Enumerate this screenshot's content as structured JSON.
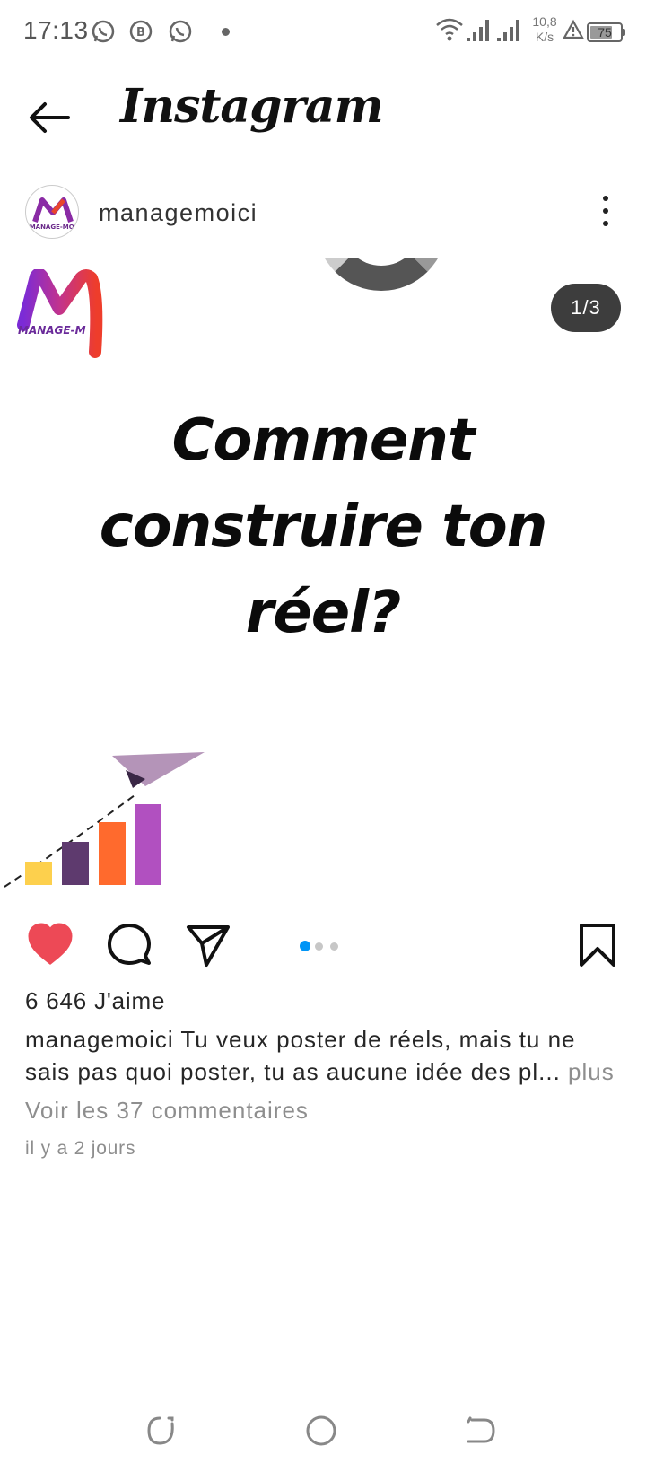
{
  "status_bar": {
    "time": "17:13",
    "notification_icons": [
      "whatsapp-icon",
      "b-app-icon",
      "whatsapp-icon"
    ],
    "network_speed_value": "10,8",
    "network_speed_unit": "K/s",
    "battery_level": "75",
    "icons": [
      "wifi-icon",
      "signal-icon",
      "signal-icon",
      "alert-icon",
      "battery-icon"
    ]
  },
  "header": {
    "title": "Instagram",
    "back_icon": "arrow-left-icon"
  },
  "post": {
    "username": "managemoici",
    "avatar_text": "MANAGE-MOI",
    "more_icon": "more-vertical-icon",
    "slide_index": "1/3",
    "slide_count": 3,
    "active_slide": 1,
    "slide_brand": "MANAGE-M",
    "slide_heading": "Comment construire ton réel?",
    "likes_text": "6 646 J'aime",
    "caption_username": "managemoici",
    "caption_text": " Tu veux poster de réels, mais tu ne sais pas quoi poster, tu as aucune idée des pl...",
    "caption_more": " plus",
    "comments_link": "Voir les 37 commentaires",
    "time_ago": "il y a 2 jours",
    "liked": true,
    "action_icons": [
      "heart-icon",
      "comment-icon",
      "share-icon",
      "bookmark-icon"
    ]
  },
  "colors": {
    "like_red": "#ed4956",
    "dot_active": "#0095f6",
    "dot_inactive": "#c7c7c7",
    "bar_yellow": "#fdd04d",
    "bar_purple_dark": "#5e3a6e",
    "bar_orange": "#ff6a2d",
    "bar_purple": "#b150c0",
    "plane": "#b494b8"
  },
  "nav_bar": {
    "icons": [
      "recent-apps-icon",
      "home-icon",
      "back-nav-icon"
    ]
  }
}
